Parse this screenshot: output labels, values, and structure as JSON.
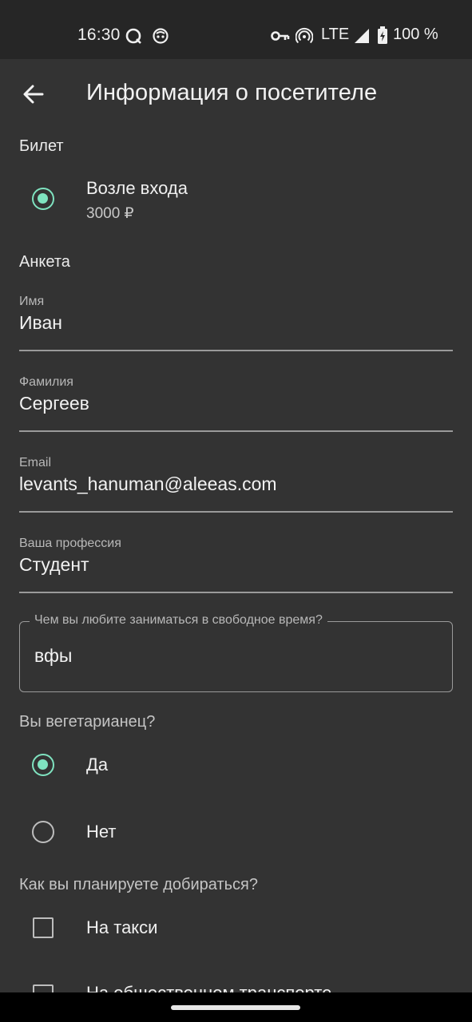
{
  "status_bar": {
    "time": "16:30",
    "network": "LTE",
    "battery": "100 %",
    "icons": [
      "chat-notification-icon",
      "app-notification-icon",
      "vpn-key-icon",
      "hotspot-icon",
      "signal-icon",
      "battery-charging-icon"
    ]
  },
  "app_bar": {
    "back_icon": "arrow-left-icon",
    "title": "Информация о посетителе"
  },
  "ticket": {
    "section_label": "Билет",
    "option_label": "Возле входа",
    "option_price": "3000 ₽",
    "selected": true
  },
  "form": {
    "section_label": "Анкета",
    "first_name": {
      "label": "Имя",
      "value": "Иван"
    },
    "last_name": {
      "label": "Фамилия",
      "value": "Сергеев"
    },
    "email": {
      "label": "Email",
      "value": "levants_hanuman@aleeas.com"
    },
    "profession": {
      "label": "Ваша профессия",
      "value": "Студент"
    },
    "hobby": {
      "label": "Чем вы любите заниматься в свободное время?",
      "value": "вфы"
    },
    "vegetarian": {
      "question": "Вы вегетарианец?",
      "options": [
        {
          "label": "Да",
          "selected": true
        },
        {
          "label": "Нет",
          "selected": false
        }
      ]
    },
    "transport": {
      "question": "Как вы планируете добираться?",
      "options": [
        {
          "label": "На такси",
          "checked": false
        },
        {
          "label": "На общественном транспорте",
          "checked": false
        }
      ]
    }
  },
  "colors": {
    "accent": "#7fe3c0",
    "background": "#333333",
    "status_bar": "#262626"
  }
}
